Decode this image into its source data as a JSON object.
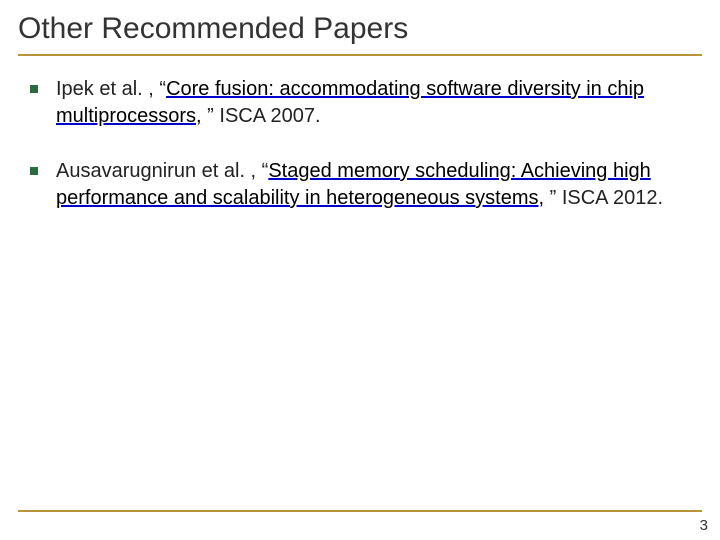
{
  "title": "Other Recommended Papers",
  "bullets": [
    {
      "prefix": "Ipek et al. , “",
      "link": "Core fusion: accommodating software diversity in chip multiprocessors,",
      "suffix": " ” ISCA 2007."
    },
    {
      "prefix": "Ausavarugnirun et al. , “",
      "link": "Staged memory scheduling: Achieving high performance and scalability in heterogeneous systems,",
      "suffix": " ” ISCA 2012."
    }
  ],
  "page_number": "3"
}
